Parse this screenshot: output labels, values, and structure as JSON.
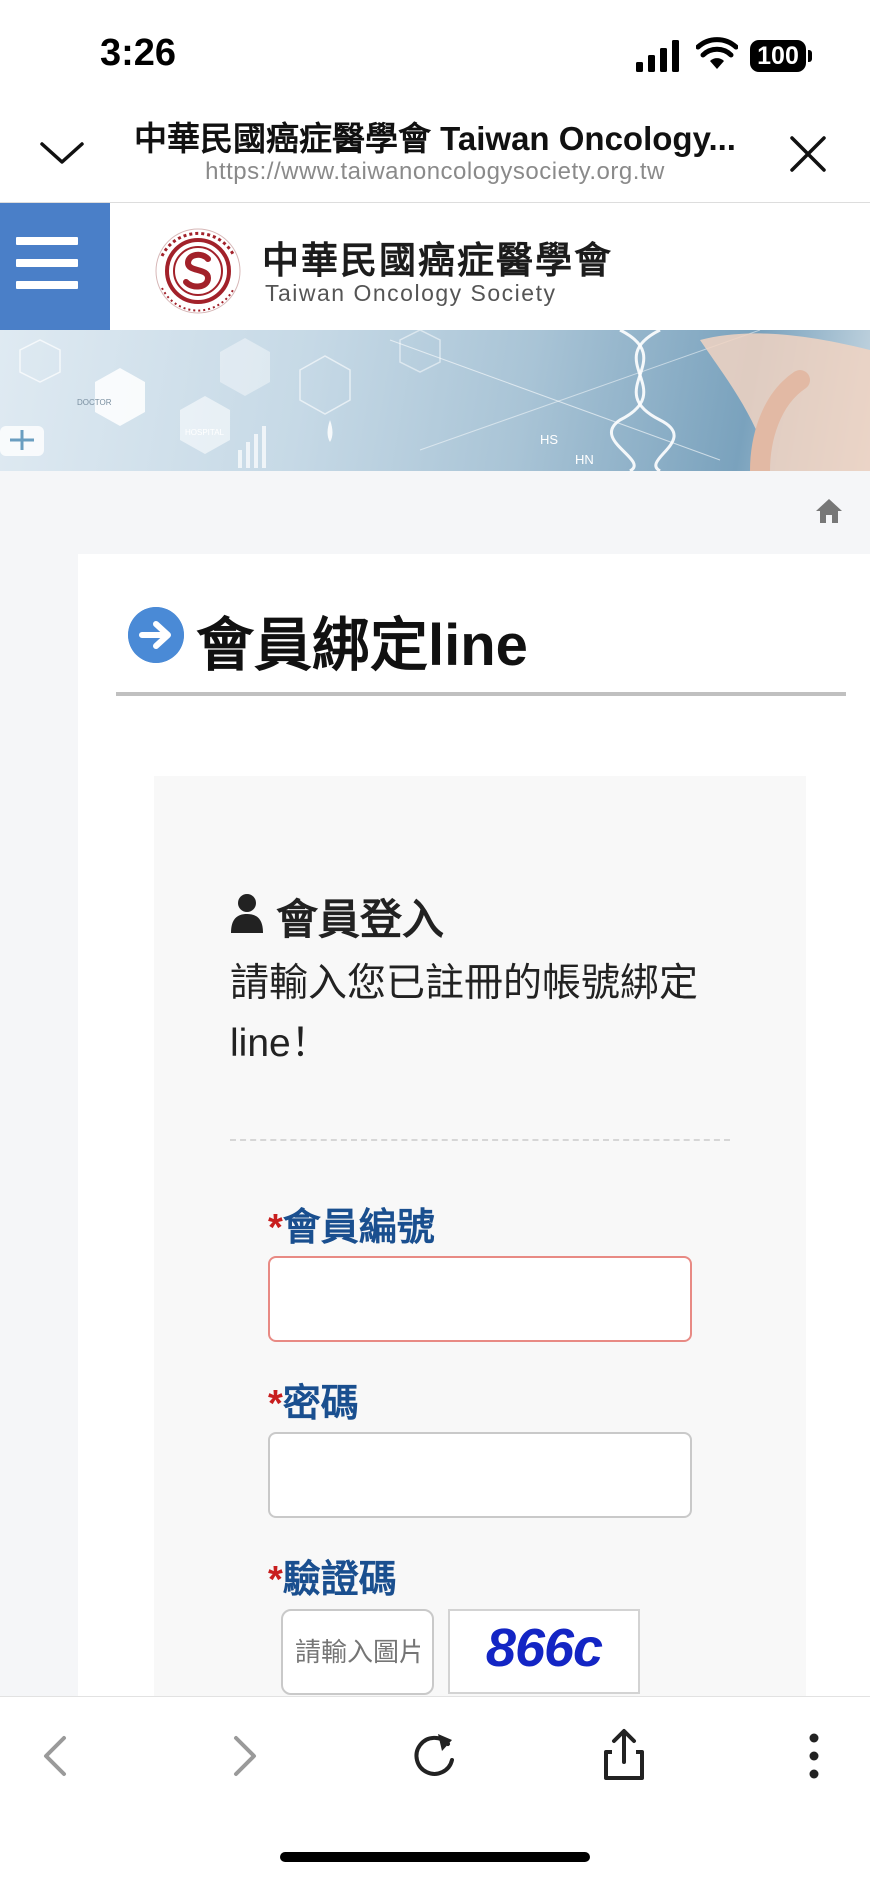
{
  "status_bar": {
    "time": "3:26",
    "battery": "100"
  },
  "browser": {
    "title": "中華民國癌症醫學會 Taiwan Oncology...",
    "url": "https://www.taiwanoncologysociety.org.tw"
  },
  "site": {
    "name_zh": "中華民國癌症醫學會",
    "name_en": "Taiwan Oncology Society"
  },
  "banner": {
    "label_hs": "HS",
    "label_hn": "HN",
    "label_hospital": "HOSPITAL",
    "label_doctor": "DOCTOR"
  },
  "page": {
    "heading": "會員綁定line"
  },
  "login": {
    "title": "會員登入",
    "description": "請輸入您已註冊的帳號綁定line！",
    "required_mark": "*",
    "fields": {
      "member_id": {
        "label": "會員編號",
        "value": ""
      },
      "password": {
        "label": "密碼",
        "value": ""
      },
      "captcha": {
        "label": "驗證碼",
        "placeholder": "請輸入圖片",
        "image_text": "866c"
      }
    }
  },
  "colors": {
    "accent": "#4a7fc8",
    "label": "#1a4f8f",
    "required": "#c81e1e",
    "error_border": "#e88a84"
  }
}
